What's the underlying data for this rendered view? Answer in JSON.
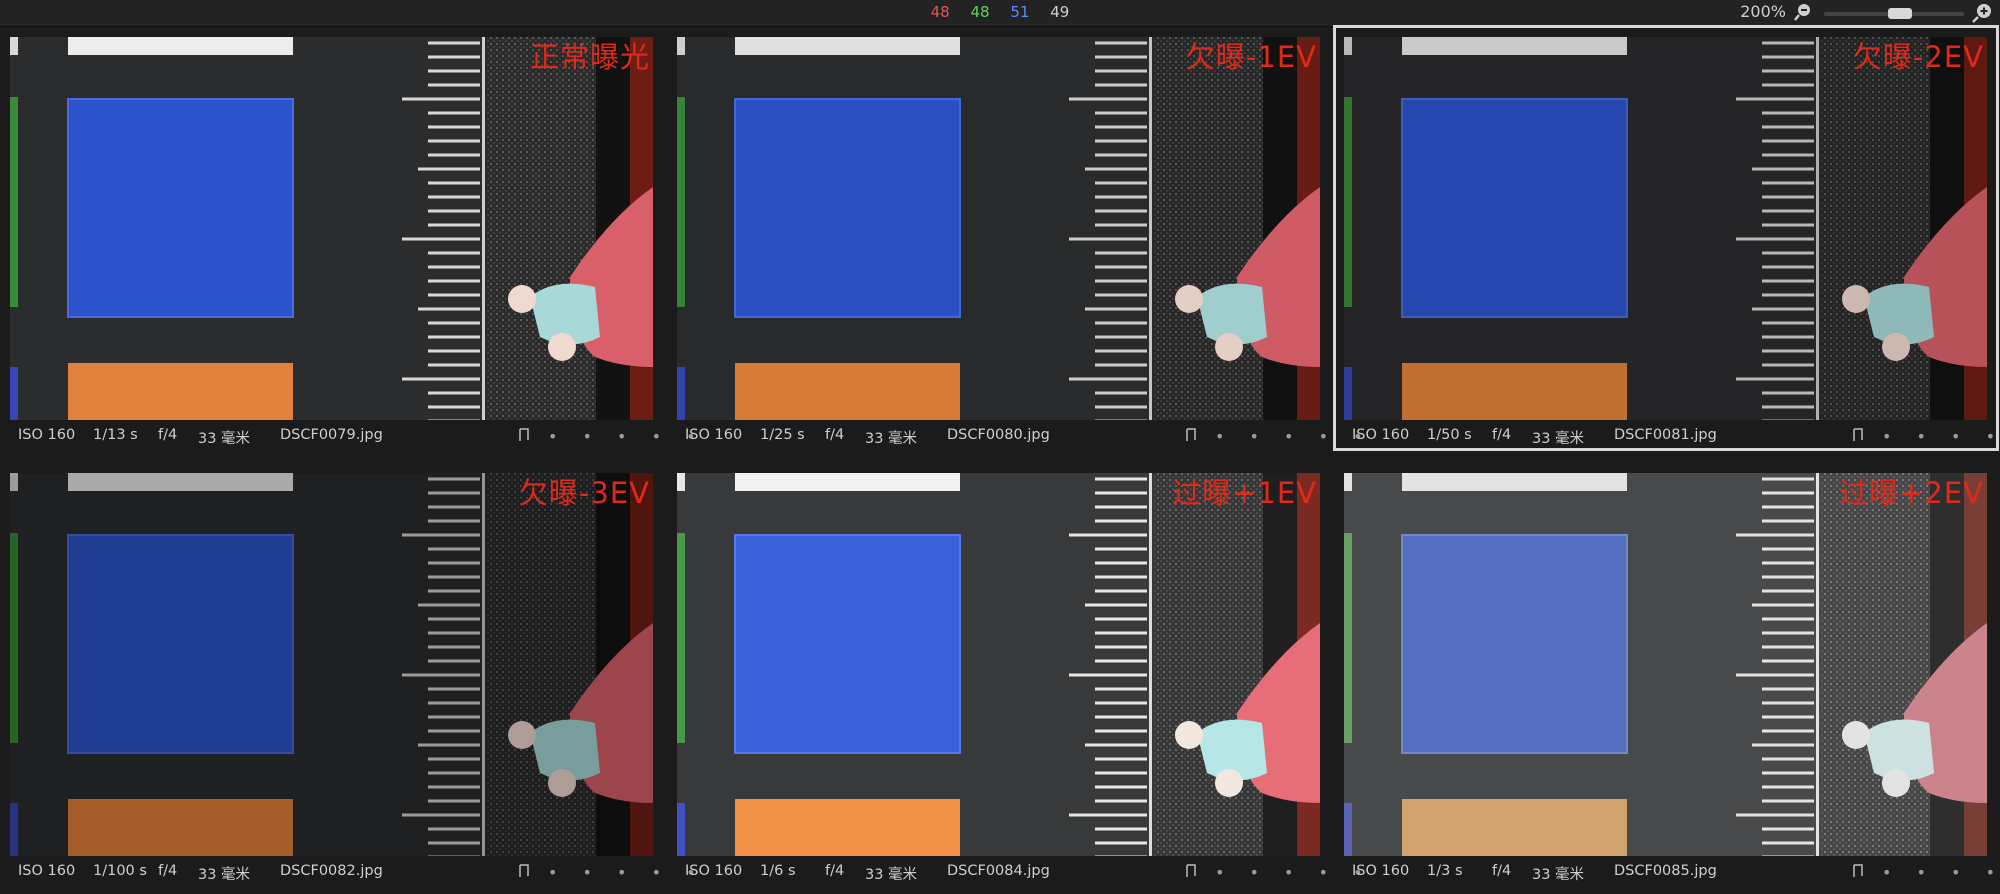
{
  "toolbar": {
    "rgb": {
      "r": "48",
      "g": "48",
      "b": "51",
      "l": "49"
    },
    "zoom": "200%"
  },
  "colors": {
    "r": "#e05a4e",
    "g": "#5cd65c",
    "b": "#5a8cff",
    "l": "#cfcfcf",
    "ev_label": "#e0291a"
  },
  "photos": [
    {
      "ev_label": "正常曝光",
      "iso": "ISO 160",
      "shutter": "1/13 s",
      "aperture": "f/4",
      "focal": "33 毫米",
      "filename": "DSCF0079.jpg",
      "rating_dots": "• • • • •"
    },
    {
      "ev_label": "欠曝-1EV",
      "iso": "ISO 160",
      "shutter": "1/25 s",
      "aperture": "f/4",
      "focal": "33 毫米",
      "filename": "DSCF0080.jpg",
      "rating_dots": "• • • • •"
    },
    {
      "ev_label": "欠曝-2EV",
      "iso": "ISO 160",
      "shutter": "1/50 s",
      "aperture": "f/4",
      "focal": "33 毫米",
      "filename": "DSCF0081.jpg",
      "rating_dots": "• • • • •"
    },
    {
      "ev_label": "欠曝-3EV",
      "iso": "ISO 160",
      "shutter": "1/100 s",
      "aperture": "f/4",
      "focal": "33 毫米",
      "filename": "DSCF0082.jpg",
      "rating_dots": "• • • • •"
    },
    {
      "ev_label": "过曝+1EV",
      "iso": "ISO 160",
      "shutter": "1/6 s",
      "aperture": "f/4",
      "focal": "33 毫米",
      "filename": "DSCF0084.jpg",
      "rating_dots": "• • • • •"
    },
    {
      "ev_label": "过曝+2EV",
      "iso": "ISO 160",
      "shutter": "1/3 s",
      "aperture": "f/4",
      "focal": "33 毫米",
      "filename": "DSCF0085.jpg",
      "rating_dots": "• • • • •"
    }
  ]
}
